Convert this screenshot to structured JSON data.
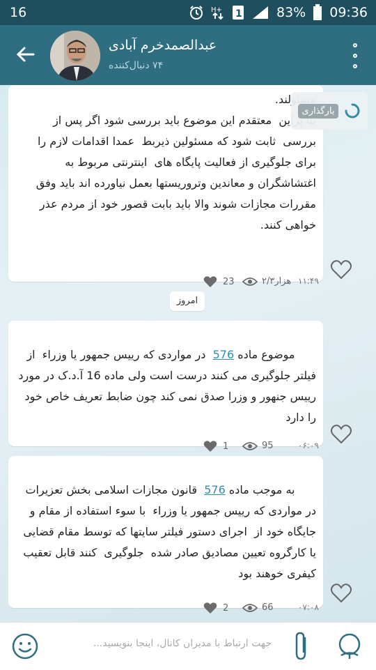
{
  "status_bar": {
    "notification_count": "16",
    "battery_percent": "83%",
    "time": "09:36"
  },
  "channel": {
    "title": "عبدالصمدخرم آبادی",
    "subtitle": "۷۴ دنبال‌کننده"
  },
  "loading": {
    "label": "بارگذاری"
  },
  "messages": [
    {
      "text": "مسئولند.\nبنا براین  معتقدم این موضوع باید بررسی شود اگر پس از بررسی  ثابت شود که مسئولین ذیربط  عمدا اقدامات لازم را برای جلوگیری از فعالیت پایگاه های  اینترنتی مربوط به اغتشاشگران و معاندین وتروریستها بعمل نیاورده اند باید وفق مقررات مجازات شوند والا باید بابت قصور خود از مردم عذر خواهی کنند.",
      "time": "۱۱:۴۹",
      "views": "۲/۳هزار",
      "likes": "23"
    },
    {
      "text_before": "موضوع ماده ",
      "link": "576",
      "text_after": "  در مواردی که رییس جمهور یا وزراء  از فیلتر جلوگیری می کنند درست است ولی ماده 16 آ.د.ک در مورد رییس جنهور و وزرا صدق نمی کند چون ضابط تعریف خاص خود را دارد",
      "time": "۰۶:۰۹",
      "views": "95",
      "likes": "1"
    },
    {
      "text_before": "به موجب ماده ",
      "link": "576",
      "text_after": "  قانون مجازات اسلامی بخش تعزیرات در مواردی که رییس جمهور یا وزراء  با سوء استفاده از مقام و جایگاه خود از  اجرای دستور فیلتر سایتها که توسط مقام قضایی یا کارگروه تعیین مصادیق صادر شده  جلوگیری  کنند قابل تعقیب کیفری خوهند بود",
      "time": "۰۷:۰۸",
      "views": "66",
      "likes": "2"
    }
  ],
  "date_chip": "امروز",
  "composer": {
    "placeholder": "جهت ارتباط با مدیران کانال، اینجا بنویسید..."
  },
  "colors": {
    "status_bar": "#1f4f5e",
    "top_bar": "#2e6e80",
    "link": "#2e8fb5"
  },
  "icons": [
    "back-arrow-icon",
    "overflow-menu-icon",
    "heart-icon",
    "eye-icon",
    "emoji-icon",
    "attach-icon",
    "mic-icon",
    "spinner-icon"
  ]
}
